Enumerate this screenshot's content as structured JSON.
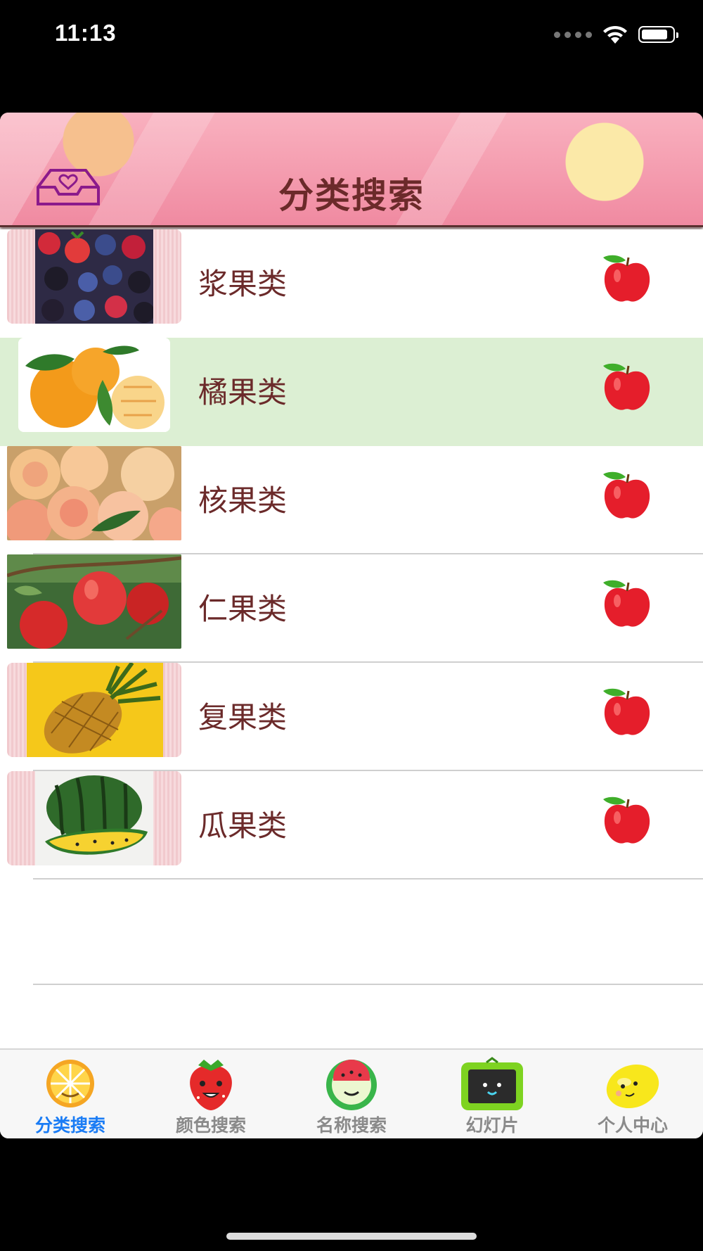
{
  "status": {
    "time": "11:13"
  },
  "navbar": {
    "title": "分类搜索"
  },
  "rows": [
    {
      "label": "浆果类",
      "image": "berries"
    },
    {
      "label": "橘果类",
      "image": "oranges",
      "highlighted": true
    },
    {
      "label": "核果类",
      "image": "peaches"
    },
    {
      "label": "仁果类",
      "image": "apples"
    },
    {
      "label": "复果类",
      "image": "pineapple"
    },
    {
      "label": "瓜果类",
      "image": "watermelon"
    }
  ],
  "tabs": [
    {
      "label": "分类搜索",
      "icon": "orange-icon",
      "active": true
    },
    {
      "label": "颜色搜索",
      "icon": "strawberry-icon"
    },
    {
      "label": "名称搜索",
      "icon": "watermelon-icon"
    },
    {
      "label": "幻灯片",
      "icon": "tv-icon"
    },
    {
      "label": "个人中心",
      "icon": "lemon-icon"
    }
  ],
  "colors": {
    "accent": "#1a7cf5",
    "title": "#6b2a2a",
    "highlight": "#dcefd3"
  }
}
